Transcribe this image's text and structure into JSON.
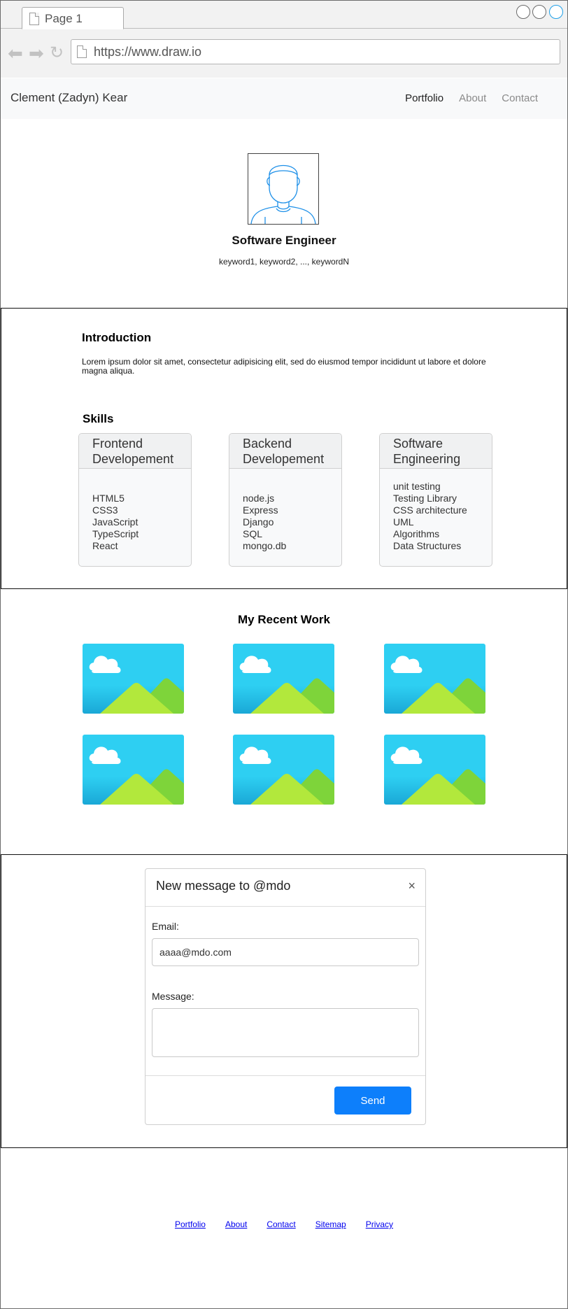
{
  "browser": {
    "tab_title": "Page 1",
    "url": "https://www.draw.io"
  },
  "site": {
    "brand": "Clement (Zadyn) Kear",
    "nav": [
      {
        "label": "Portfolio",
        "active": true
      },
      {
        "label": "About",
        "active": false
      },
      {
        "label": "Contact",
        "active": false
      }
    ]
  },
  "hero": {
    "title": "Software Engineer",
    "keywords": "keyword1, keyword2, ..., keywordN"
  },
  "intro": {
    "heading": "Introduction",
    "text": "Lorem ipsum dolor sit amet, consectetur adipisicing elit, sed do eiusmod tempor incididunt ut labore et dolore magna aliqua."
  },
  "skills": {
    "heading": "Skills",
    "cards": [
      {
        "title_line1": "Frontend",
        "title_line2": "Developement",
        "items": [
          "HTML5",
          "CSS3",
          "JavaScript",
          "TypeScript",
          "React"
        ]
      },
      {
        "title_line1": "Backend",
        "title_line2": "Developement",
        "items": [
          "node.js",
          "Express",
          "Django",
          "SQL",
          "mongo.db"
        ]
      },
      {
        "title_line1": "Software",
        "title_line2": "Engineering",
        "items": [
          "unit testing",
          "Testing Library",
          "CSS architecture",
          "UML",
          "Algorithms",
          "Data Structures"
        ]
      }
    ]
  },
  "work": {
    "heading": "My Recent Work",
    "thumbnail_count": 6
  },
  "message_modal": {
    "title": "New message to @mdo",
    "close_glyph": "×",
    "email_label": "Email:",
    "email_value": "aaaa@mdo.com",
    "message_label": "Message:",
    "message_value": "",
    "send_label": "Send"
  },
  "footer": {
    "links": [
      "Portfolio",
      "About",
      "Contact",
      "Sitemap",
      "Privacy"
    ]
  },
  "colors": {
    "accent": "#0d7ffb",
    "window_button_active": "#1fa0e8",
    "avatar_stroke": "#1e90e8",
    "thumb_sky": "#2ecff2",
    "thumb_hill_front": "#b2e83c",
    "thumb_hill_back": "#7ed43a"
  }
}
